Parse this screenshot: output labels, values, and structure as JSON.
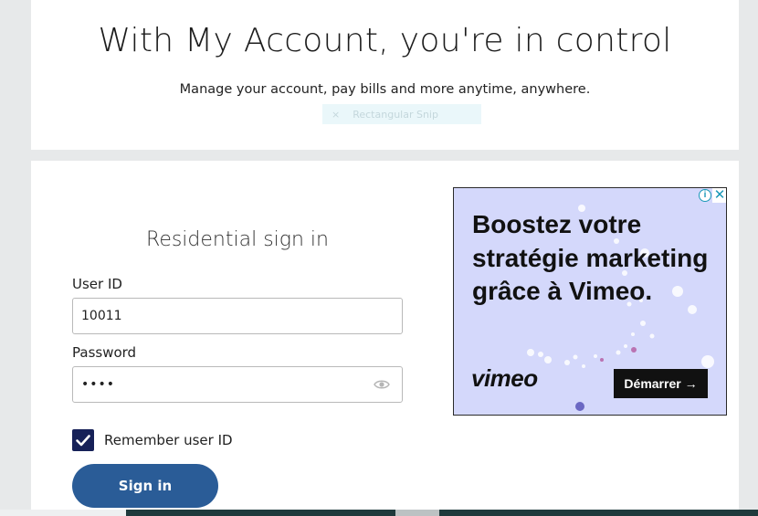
{
  "header": {
    "title": "With My Account, you're in control",
    "subtitle": "Manage your account, pay bills and more anytime, anywhere."
  },
  "snip_overlay": {
    "close": "×",
    "label": "Rectangular Snip"
  },
  "signin": {
    "title": "Residential sign in",
    "user_label": "User ID",
    "user_value": "10011",
    "password_label": "Password",
    "password_value": "••••",
    "remember_label": "Remember user ID",
    "remember_checked": true,
    "button_label": "Sign in"
  },
  "ad": {
    "headline": "Boostez votre stratégie marketing grâce à Vimeo.",
    "brand": "vimeo",
    "cta": "Démarrer →",
    "info_icon": "i",
    "close_icon": "✕",
    "background": "#d4d8fb"
  },
  "colors": {
    "page_bg": "#e7e9ea",
    "button": "#2a5c97",
    "checkbox": "#162158"
  }
}
